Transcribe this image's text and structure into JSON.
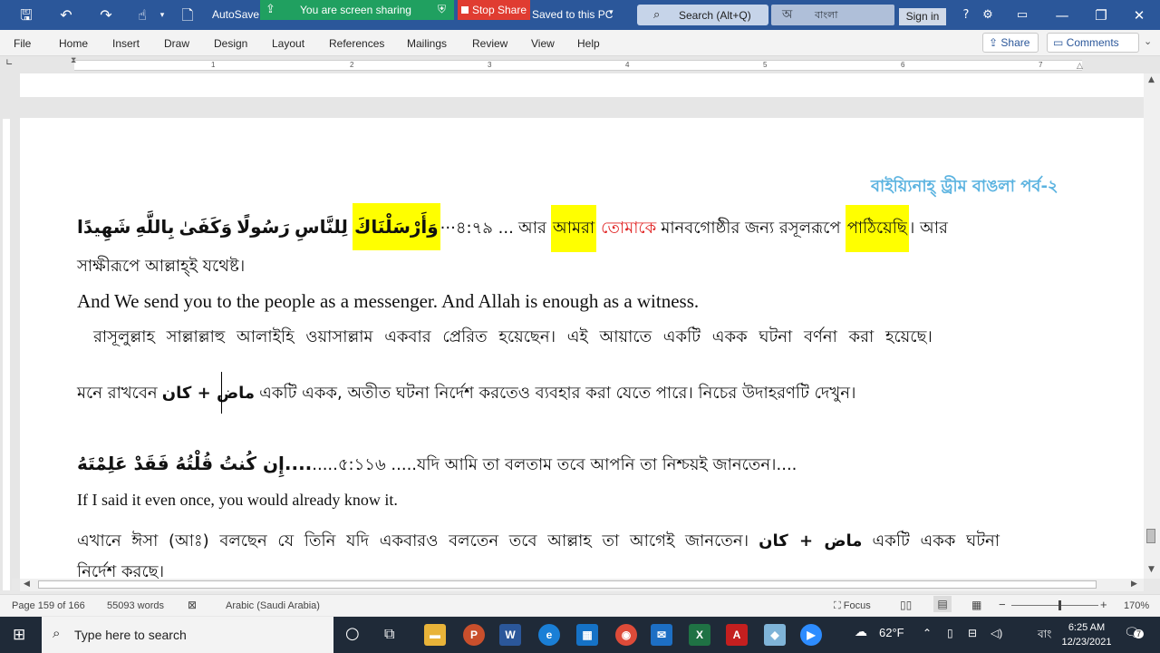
{
  "titlebar": {
    "autosave": "AutoSave",
    "saved": "Saved to this PC",
    "search": "Search (Alt+Q)",
    "lang_button": "বাংলা",
    "signin": "Sign in",
    "screen_sharing": "You are screen sharing",
    "stop_share": "Stop Share"
  },
  "menu": {
    "items": [
      "File",
      "Home",
      "Insert",
      "Draw",
      "Design",
      "Layout",
      "References",
      "Mailings",
      "Review",
      "View",
      "Help"
    ],
    "share": "Share",
    "comments": "Comments"
  },
  "ruler": {
    "numbers": [
      "1",
      "2",
      "3",
      "4",
      "5",
      "6",
      "7"
    ]
  },
  "document": {
    "header_title": "বাইয়্যিনাহ্ ড্রীম বাঙলা পর্ব-২",
    "verse1_arabic_a": "شَهِيدًا",
    "verse1_arabic_b": "بِاللَّهِ",
    "verse1_arabic_c": "وَكَفَىٰ",
    "verse1_arabic_d": "رَسُولًا",
    "verse1_arabic_e": "لِلنَّاسِ",
    "verse1_arabic_hl": "وَأَرْسَلْنَاكَ",
    "verse1_ref": "···৪:৭৯ ...",
    "verse1_bn_a": "আর",
    "verse1_bn_hl1": "আমরা",
    "verse1_bn_red": "তোমাকে",
    "verse1_bn_b": "মানবগোষ্ঠীর জন্য রসূলরূপে",
    "verse1_bn_hl2": "পাঠিয়েছি",
    "verse1_bn_c": "। আর",
    "verse1_line2": "সাক্ষীরূপে আল্লাহ্‌ই যথেষ্ট।",
    "verse1_en": "And We send you to the people as a messenger. And Allah is enough as a witness.",
    "para1": "রাসূলুল্লাহ সাল্লাল্লাহু আলাইহি ওয়াসাল্লাম একবার প্রেরিত হয়েছেন। এই আয়াতে একটি একক ঘটনা বর্ণনা করা হয়েছে।",
    "para2_a": "মনে রাখবেন",
    "para2_ar": "ماض + كان",
    "para2_b": "একটি একক, অতীত ঘটনা নির্দেশ করতেও ব্যবহার করা যেতে পারে। নিচের উদাহরণটি দেখুন।",
    "verse2_arabic": "....إِن كُنتُ قُلْتُهُ فَقَدْ عَلِمْتَهُ",
    "verse2_ref": ".....৫:১১৬ .....",
    "verse2_bn": "যদি আমি তা বলতাম তবে আপনি তা নিশ্চয়ই জানতেন।....",
    "verse2_en": "If I said it even once, you would already know it.",
    "para3_a": "এখানে ঈসা (আঃ) বলছেন যে তিনি যদি একবারও বলতেন তবে আল্লাহ তা আগেই জানতেন।",
    "para3_ar": "ماض + كان",
    "para3_b": "একটি একক ঘটনা",
    "para3_line2": "নির্দেশ করছে।"
  },
  "status": {
    "page": "Page 159 of 166",
    "words": "55093 words",
    "language": "Arabic (Saudi Arabia)",
    "focus": "Focus",
    "zoom": "170%"
  },
  "taskbar": {
    "search_placeholder": "Type here to search",
    "weather": "62°F",
    "lang": "বাং",
    "time": "6:25 AM",
    "date": "12/23/2021",
    "notifications": "7"
  },
  "colors": {
    "title_bar": "#2b579a",
    "highlight": "#ffff00",
    "header_title": "#5bb3e0",
    "red_text": "#e02020"
  }
}
